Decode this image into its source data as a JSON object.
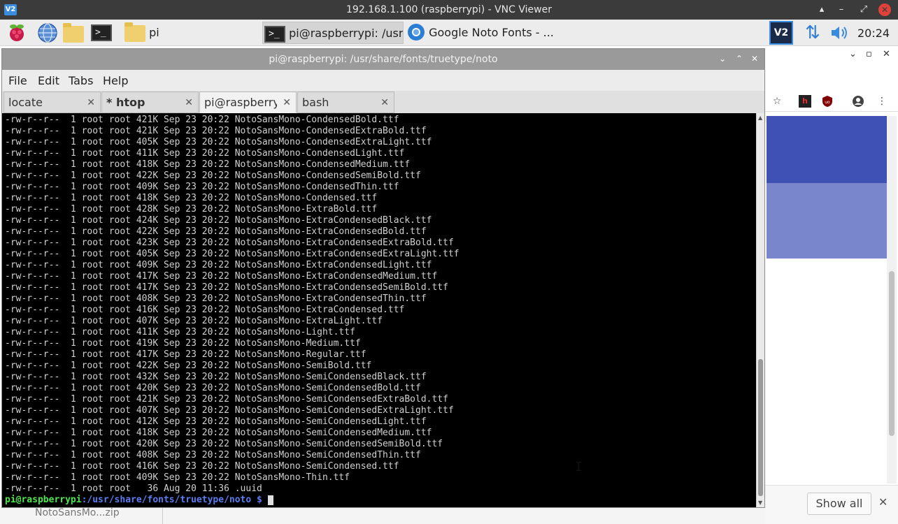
{
  "vnc": {
    "logo": "V2",
    "title": "192.168.1.100 (raspberrypi) - VNC Viewer",
    "controls": [
      "▴",
      "–",
      "⤢",
      "✕"
    ]
  },
  "taskbar": {
    "folder_label": "pi",
    "terminal_task": "pi@raspberrypi: /usr/...",
    "browser_task": "Google Noto Fonts - ...",
    "clock": "20:24"
  },
  "terminal": {
    "title": "pi@raspberrypi: /usr/share/fonts/truetype/noto",
    "menu": [
      "File",
      "Edit",
      "Tabs",
      "Help"
    ],
    "tabs": [
      {
        "label": "locate",
        "bold": false,
        "active": false
      },
      {
        "label": "* htop",
        "bold": true,
        "active": false
      },
      {
        "label": "pi@raspberrypi: /usr/share/fonts/truetype/noto",
        "bold": false,
        "active": true
      },
      {
        "label": "bash",
        "bold": false,
        "active": false
      }
    ],
    "lines": [
      "-rw-r--r--  1 root root 421K Sep 23 20:22 NotoSansMono-CondensedBold.ttf",
      "-rw-r--r--  1 root root 421K Sep 23 20:22 NotoSansMono-CondensedExtraBold.ttf",
      "-rw-r--r--  1 root root 405K Sep 23 20:22 NotoSansMono-CondensedExtraLight.ttf",
      "-rw-r--r--  1 root root 411K Sep 23 20:22 NotoSansMono-CondensedLight.ttf",
      "-rw-r--r--  1 root root 418K Sep 23 20:22 NotoSansMono-CondensedMedium.ttf",
      "-rw-r--r--  1 root root 422K Sep 23 20:22 NotoSansMono-CondensedSemiBold.ttf",
      "-rw-r--r--  1 root root 409K Sep 23 20:22 NotoSansMono-CondensedThin.ttf",
      "-rw-r--r--  1 root root 418K Sep 23 20:22 NotoSansMono-Condensed.ttf",
      "-rw-r--r--  1 root root 428K Sep 23 20:22 NotoSansMono-ExtraBold.ttf",
      "-rw-r--r--  1 root root 424K Sep 23 20:22 NotoSansMono-ExtraCondensedBlack.ttf",
      "-rw-r--r--  1 root root 422K Sep 23 20:22 NotoSansMono-ExtraCondensedBold.ttf",
      "-rw-r--r--  1 root root 423K Sep 23 20:22 NotoSansMono-ExtraCondensedExtraBold.ttf",
      "-rw-r--r--  1 root root 405K Sep 23 20:22 NotoSansMono-ExtraCondensedExtraLight.ttf",
      "-rw-r--r--  1 root root 409K Sep 23 20:22 NotoSansMono-ExtraCondensedLight.ttf",
      "-rw-r--r--  1 root root 417K Sep 23 20:22 NotoSansMono-ExtraCondensedMedium.ttf",
      "-rw-r--r--  1 root root 417K Sep 23 20:22 NotoSansMono-ExtraCondensedSemiBold.ttf",
      "-rw-r--r--  1 root root 408K Sep 23 20:22 NotoSansMono-ExtraCondensedThin.ttf",
      "-rw-r--r--  1 root root 416K Sep 23 20:22 NotoSansMono-ExtraCondensed.ttf",
      "-rw-r--r--  1 root root 407K Sep 23 20:22 NotoSansMono-ExtraLight.ttf",
      "-rw-r--r--  1 root root 411K Sep 23 20:22 NotoSansMono-Light.ttf",
      "-rw-r--r--  1 root root 419K Sep 23 20:22 NotoSansMono-Medium.ttf",
      "-rw-r--r--  1 root root 417K Sep 23 20:22 NotoSansMono-Regular.ttf",
      "-rw-r--r--  1 root root 422K Sep 23 20:22 NotoSansMono-SemiBold.ttf",
      "-rw-r--r--  1 root root 432K Sep 23 20:22 NotoSansMono-SemiCondensedBlack.ttf",
      "-rw-r--r--  1 root root 420K Sep 23 20:22 NotoSansMono-SemiCondensedBold.ttf",
      "-rw-r--r--  1 root root 421K Sep 23 20:22 NotoSansMono-SemiCondensedExtraBold.ttf",
      "-rw-r--r--  1 root root 407K Sep 23 20:22 NotoSansMono-SemiCondensedExtraLight.ttf",
      "-rw-r--r--  1 root root 412K Sep 23 20:22 NotoSansMono-SemiCondensedLight.ttf",
      "-rw-r--r--  1 root root 418K Sep 23 20:22 NotoSansMono-SemiCondensedMedium.ttf",
      "-rw-r--r--  1 root root 420K Sep 23 20:22 NotoSansMono-SemiCondensedSemiBold.ttf",
      "-rw-r--r--  1 root root 408K Sep 23 20:22 NotoSansMono-SemiCondensedThin.ttf",
      "-rw-r--r--  1 root root 416K Sep 23 20:22 NotoSansMono-SemiCondensed.ttf",
      "-rw-r--r--  1 root root 409K Sep 23 20:22 NotoSansMono-Thin.ttf",
      "-rw-r--r--  1 root root   36 Aug 20 11:36 .uuid"
    ],
    "prompt_user": "pi@raspberrypi",
    "prompt_path": ":/usr/share/fonts/truetype/noto $"
  },
  "browser": {
    "notify_button": "Show all"
  },
  "below": {
    "filename": "NotoSansMo...zip"
  },
  "colors": {
    "terminal_bg": "#000000",
    "terminal_fg": "#d0d0d0",
    "prompt_user": "#4ee64e",
    "prompt_path": "#5a7cf0",
    "browser_accent": "#3f51b5"
  }
}
